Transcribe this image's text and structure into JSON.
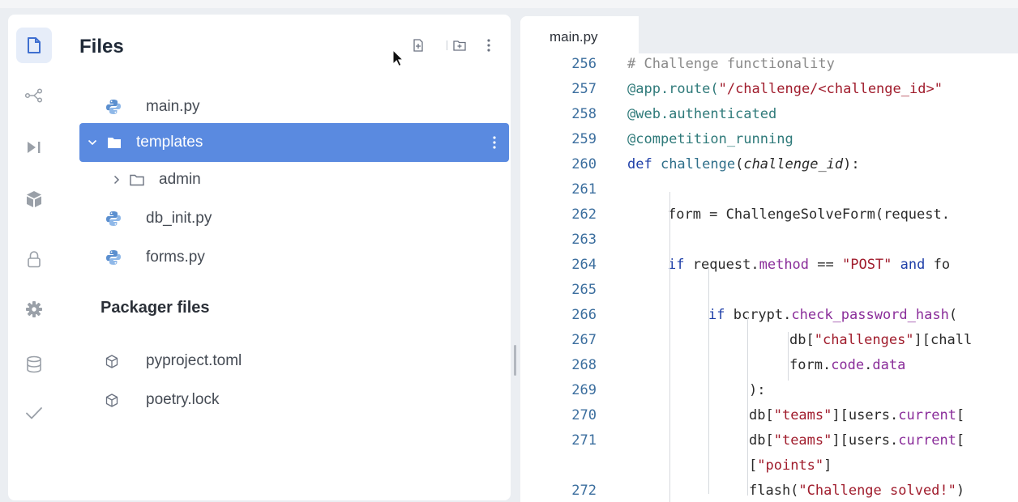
{
  "sidebar": {
    "rail_icons": [
      {
        "name": "file-icon",
        "active": true
      },
      {
        "name": "git-branch-icon",
        "active": false
      },
      {
        "name": "play-icon",
        "active": false
      },
      {
        "name": "package-icon",
        "active": false
      },
      {
        "name": "lock-icon",
        "active": false
      },
      {
        "name": "gear-icon",
        "active": false
      },
      {
        "name": "database-icon",
        "active": false
      },
      {
        "name": "checkmark-icon",
        "active": false
      }
    ]
  },
  "files_panel": {
    "title": "Files",
    "actions": [
      "new-file-icon",
      "new-folder-icon",
      "more-options-icon"
    ],
    "tree": [
      {
        "label": "main.py",
        "icon": "python-icon"
      },
      {
        "label": "templates",
        "icon": "folder-icon",
        "expanded": true,
        "selected": true
      },
      {
        "label": "admin",
        "icon": "folder-outline-icon",
        "expanded": false
      },
      {
        "label": "db_init.py",
        "icon": "python-icon"
      },
      {
        "label": "forms.py",
        "icon": "python-icon"
      }
    ],
    "packager_title": "Packager files",
    "packager_files": [
      {
        "label": "pyproject.toml",
        "icon": "package-outline-icon"
      },
      {
        "label": "poetry.lock",
        "icon": "package-outline-icon"
      }
    ]
  },
  "editor": {
    "tab": "main.py",
    "lines": [
      {
        "n": "256",
        "indent": 0,
        "tokens": [
          {
            "t": "# Challenge functionality",
            "c": "comment"
          }
        ]
      },
      {
        "n": "257",
        "indent": 0,
        "tokens": [
          {
            "t": "@app.route(",
            "c": "decor"
          },
          {
            "t": "\"/challenge/<challenge_id>\"",
            "c": "str"
          }
        ]
      },
      {
        "n": "258",
        "indent": 0,
        "tokens": [
          {
            "t": "@web.authenticated",
            "c": "decor"
          }
        ]
      },
      {
        "n": "259",
        "indent": 0,
        "tokens": [
          {
            "t": "@competition_running",
            "c": "decor"
          }
        ]
      },
      {
        "n": "260",
        "indent": 0,
        "tokens": [
          {
            "t": "def ",
            "c": "kw"
          },
          {
            "t": "challenge",
            "c": "fn"
          },
          {
            "t": "(",
            "c": "plain"
          },
          {
            "t": "challenge_id",
            "c": "param"
          },
          {
            "t": "):",
            "c": "plain"
          }
        ]
      },
      {
        "n": "261",
        "indent": 0,
        "tokens": []
      },
      {
        "n": "262",
        "indent": 1,
        "tokens": [
          {
            "t": "form = ChallengeSolveForm(request.",
            "c": "plain"
          }
        ]
      },
      {
        "n": "263",
        "indent": 0,
        "tokens": []
      },
      {
        "n": "264",
        "indent": 1,
        "tokens": [
          {
            "t": "if ",
            "c": "kw"
          },
          {
            "t": "request.",
            "c": "plain"
          },
          {
            "t": "method",
            "c": "attr"
          },
          {
            "t": " == ",
            "c": "plain"
          },
          {
            "t": "\"POST\"",
            "c": "str"
          },
          {
            "t": " and ",
            "c": "kw"
          },
          {
            "t": "fo",
            "c": "plain"
          }
        ]
      },
      {
        "n": "265",
        "indent": 0,
        "tokens": []
      },
      {
        "n": "266",
        "indent": 2,
        "tokens": [
          {
            "t": "if ",
            "c": "kw"
          },
          {
            "t": "bcrypt.",
            "c": "plain"
          },
          {
            "t": "check_password_hash",
            "c": "attr"
          },
          {
            "t": "(",
            "c": "plain"
          }
        ]
      },
      {
        "n": "267",
        "indent": 4,
        "tokens": [
          {
            "t": "db[",
            "c": "plain"
          },
          {
            "t": "\"challenges\"",
            "c": "str"
          },
          {
            "t": "][chall",
            "c": "plain"
          }
        ]
      },
      {
        "n": "268",
        "indent": 4,
        "tokens": [
          {
            "t": "form.",
            "c": "plain"
          },
          {
            "t": "code",
            "c": "attr"
          },
          {
            "t": ".",
            "c": "plain"
          },
          {
            "t": "data",
            "c": "attr"
          }
        ]
      },
      {
        "n": "269",
        "indent": 3,
        "tokens": [
          {
            "t": "):",
            "c": "plain"
          }
        ]
      },
      {
        "n": "270",
        "indent": 3,
        "tokens": [
          {
            "t": "db[",
            "c": "plain"
          },
          {
            "t": "\"teams\"",
            "c": "str"
          },
          {
            "t": "][users.",
            "c": "plain"
          },
          {
            "t": "current",
            "c": "attr"
          },
          {
            "t": "[",
            "c": "plain"
          }
        ]
      },
      {
        "n": "271",
        "indent": 3,
        "tokens": [
          {
            "t": "db[",
            "c": "plain"
          },
          {
            "t": "\"teams\"",
            "c": "str"
          },
          {
            "t": "][users.",
            "c": "plain"
          },
          {
            "t": "current",
            "c": "attr"
          },
          {
            "t": "[",
            "c": "plain"
          }
        ]
      },
      {
        "n": "",
        "indent": 3,
        "tokens": [
          {
            "t": "[",
            "c": "plain"
          },
          {
            "t": "\"points\"",
            "c": "str"
          },
          {
            "t": "]",
            "c": "plain"
          }
        ]
      },
      {
        "n": "272",
        "indent": 3,
        "tokens": [
          {
            "t": "flash(",
            "c": "plain"
          },
          {
            "t": "\"Challenge solved!\"",
            "c": "str"
          },
          {
            "t": ")",
            "c": "plain"
          }
        ]
      }
    ]
  }
}
